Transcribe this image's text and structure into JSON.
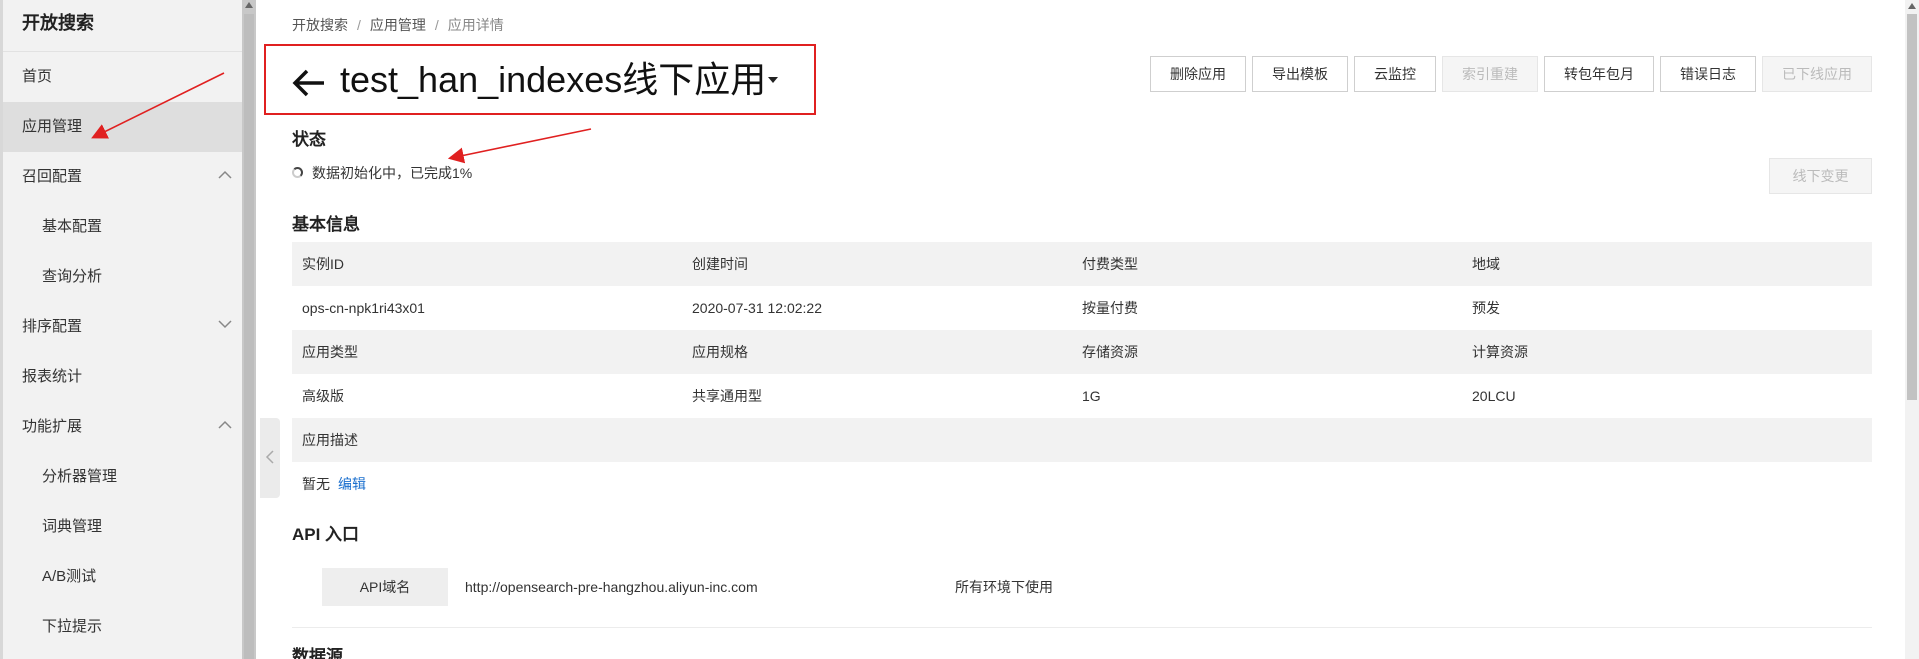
{
  "sidebar": {
    "title": "开放搜索",
    "items": [
      {
        "label": "首页"
      },
      {
        "label": "应用管理"
      },
      {
        "label": "召回配置"
      },
      {
        "label": "基本配置"
      },
      {
        "label": "查询分析"
      },
      {
        "label": "排序配置"
      },
      {
        "label": "报表统计"
      },
      {
        "label": "功能扩展"
      },
      {
        "label": "分析器管理"
      },
      {
        "label": "词典管理"
      },
      {
        "label": "A/B测试"
      },
      {
        "label": "下拉提示"
      }
    ]
  },
  "breadcrumb": [
    "开放搜索",
    "应用管理",
    "应用详情"
  ],
  "header": {
    "title": "test_han_indexes线下应用",
    "actions": [
      "删除应用",
      "导出模板",
      "云监控",
      "索引重建",
      "转包年包月",
      "错误日志",
      "已下线应用"
    ]
  },
  "status": {
    "heading": "状态",
    "text": "数据初始化中，已完成1%",
    "offline_change": "线下变更"
  },
  "basic_info": {
    "heading": "基本信息",
    "rows": [
      [
        "实例ID",
        "创建时间",
        "付费类型",
        "地域"
      ],
      [
        "ops-cn-npk1ri43x01",
        "2020-07-31 12:02:22",
        "按量付费",
        "预发"
      ],
      [
        "应用类型",
        "应用规格",
        "存储资源",
        "计算资源"
      ],
      [
        "高级版",
        "共享通用型",
        "1G",
        "20LCU"
      ]
    ],
    "desc_label": "应用描述",
    "desc_value": "暂无",
    "edit_link": "编辑"
  },
  "api": {
    "heading": "API 入口",
    "label": "API域名",
    "domain": "http://opensearch-pre-hangzhou.aliyun-inc.com",
    "note": "所有环境下使用"
  },
  "datasource": {
    "heading": "数据源"
  },
  "colors": {
    "annotation_red": "#e02020",
    "link_blue": "#1a6fce"
  }
}
